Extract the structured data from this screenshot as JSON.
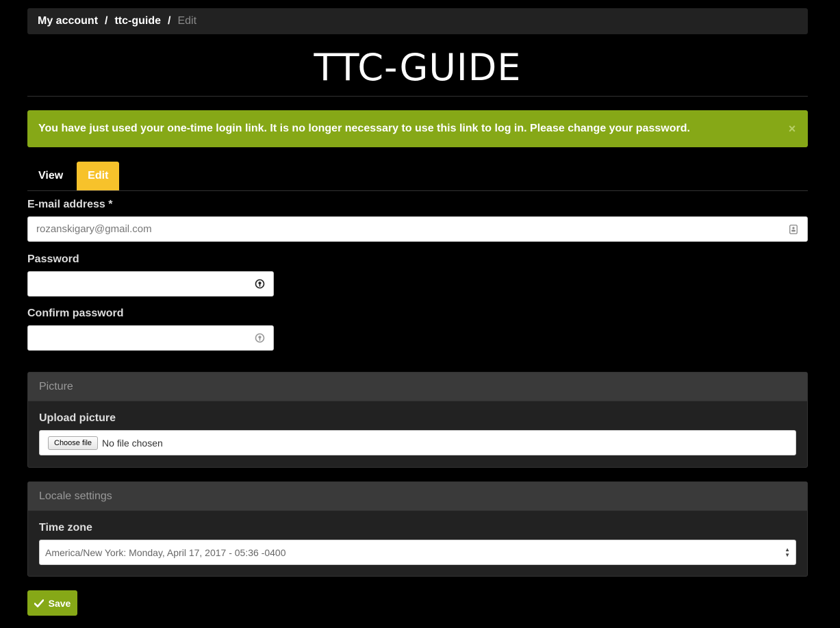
{
  "breadcrumb": {
    "items": [
      "My account",
      "ttc-guide"
    ],
    "separator": "/",
    "current": "Edit"
  },
  "site": {
    "title": "TTC-GUIDE"
  },
  "alert": {
    "message": "You have just used your one-time login link. It is no longer necessary to use this link to log in. Please change your password.",
    "close_icon": "×",
    "color": "#86a817"
  },
  "tabs": [
    {
      "label": "View",
      "active": false
    },
    {
      "label": "Edit",
      "active": true,
      "color": "#f7c22b"
    }
  ],
  "form": {
    "email": {
      "label": "E-mail address *",
      "value": "rozanskigary@gmail.com",
      "icon": "contact-card-icon"
    },
    "password": {
      "label": "Password",
      "value": "",
      "icon": "password-key-icon"
    },
    "confirm_password": {
      "label": "Confirm password",
      "value": "",
      "icon": "password-key-icon"
    }
  },
  "picture": {
    "legend": "Picture",
    "label": "Upload picture",
    "button_label": "Choose file",
    "status": "No file chosen"
  },
  "locale": {
    "legend": "Locale settings",
    "label": "Time zone",
    "selected": "America/New York: Monday, April 17, 2017 - 05:36 -0400"
  },
  "actions": {
    "save_label": "Save",
    "save_icon": "checkmark-icon"
  }
}
